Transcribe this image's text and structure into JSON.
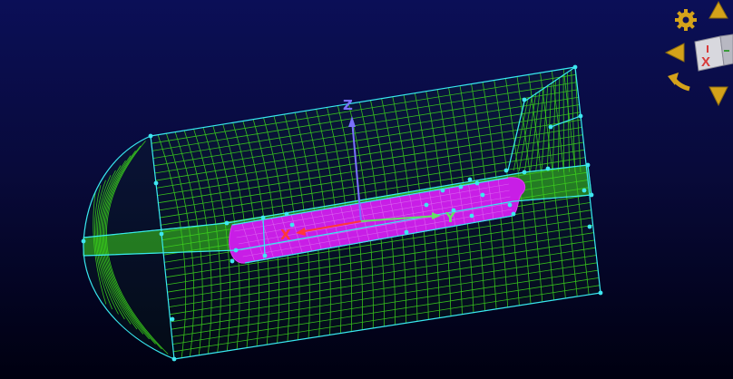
{
  "viewport": {
    "background_top": "#0b0f57",
    "background_bottom": "#000010",
    "mesh_color": "#3cd41c",
    "edge_color": "#38e8f0",
    "inner_body_color": "#c81ee6",
    "vertex_color": "#3ee6f0"
  },
  "axes": {
    "x_label": "X",
    "y_label": "Y",
    "z_label": "Z",
    "x_color": "#ff3838",
    "y_color": "#66e066",
    "z_color": "#7a70ff"
  },
  "nav_widget": {
    "cube_face_label": "X",
    "settings_icon": "gear-icon",
    "rotate_icon": "rotate-left-icon",
    "pan_left_icon": "triangle-left-icon",
    "pan_up_icon": "triangle-up-icon",
    "pan_down_icon": "triangle-down-icon",
    "arrow_color": "#d4a21a"
  }
}
